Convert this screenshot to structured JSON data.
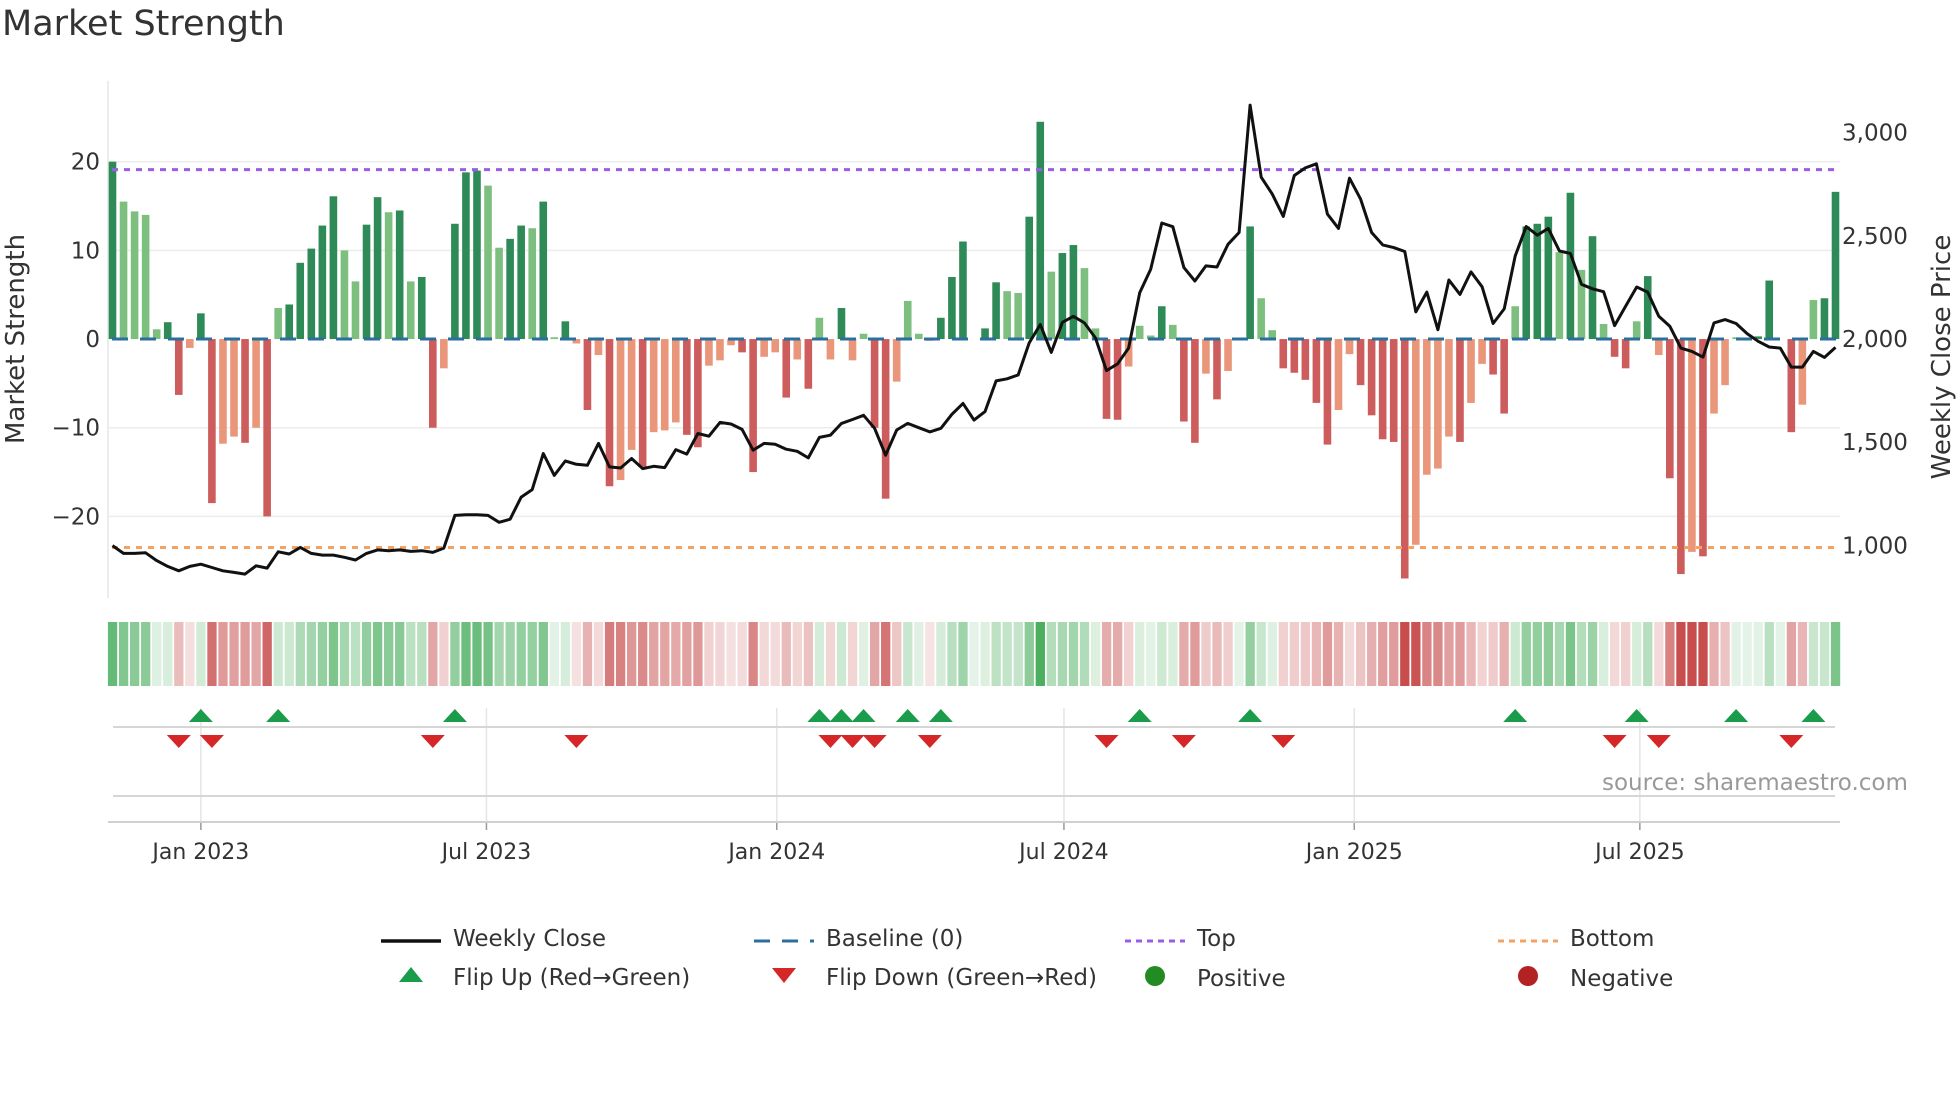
{
  "title": "Market Strength",
  "source": "source: sharemaestro.com",
  "legend": {
    "weekly_close": "Weekly Close",
    "baseline": "Baseline (0)",
    "top": "Top",
    "bottom": "Bottom",
    "flip_up": "Flip Up (Red→Green)",
    "flip_down": "Flip Down (Green→Red)",
    "positive": "Positive",
    "negative": "Negative"
  },
  "colors": {
    "strong_green": "#2e8b57",
    "weak_green": "#7dbf7f",
    "strong_red": "#cd5c5c",
    "weak_red": "#e9967a",
    "line": "#111111",
    "baseline": "#2a6f9e",
    "top": "#9b5de5",
    "bottom": "#f4a261",
    "flip_up": "#1a9c4a",
    "flip_down": "#d62728",
    "positive": "#228b22",
    "negative": "#b22222"
  },
  "chart_data": {
    "type": "bar+line",
    "title": "Market Strength",
    "ylabel": "Market Strength",
    "y2label": "Weekly Close Price",
    "start_date": "2022-11-06",
    "frequency": "weekly",
    "ylim": [
      -29.2,
      29.1
    ],
    "y2lim": [
      745,
      3250
    ],
    "yticks": [
      20,
      10,
      0,
      -10,
      -20
    ],
    "yticklabels": [
      "20",
      "10",
      "0",
      "−10",
      "−20"
    ],
    "y2ticks": [
      3000,
      2500,
      2000,
      1500,
      1000
    ],
    "y2ticklabels": [
      "3,000",
      "2,500",
      "2,000",
      "1,500",
      "1,000"
    ],
    "xticks": [
      "2023-01-01",
      "2023-07-01",
      "2024-01-01",
      "2024-07-01",
      "2025-01-01",
      "2025-07-01"
    ],
    "xticklabels": [
      "Jan 2023",
      "Jul 2023",
      "Jan 2024",
      "Jul 2024",
      "Jan 2025",
      "Jul 2025"
    ],
    "top_level": 19.1,
    "bottom_level": -23.5,
    "baseline": 0,
    "strength": [
      20,
      15.5,
      14.4,
      14,
      1.1,
      1.9,
      -6.3,
      -1,
      2.9,
      -18.5,
      -11.8,
      -11,
      -11.7,
      -10,
      -20,
      3.5,
      3.9,
      8.6,
      10.2,
      12.8,
      16.1,
      10,
      6.5,
      12.9,
      16,
      14.3,
      14.5,
      6.5,
      7,
      -10,
      -3.3,
      13,
      18.8,
      19,
      17.3,
      10.3,
      11.3,
      12.8,
      12.5,
      15.5,
      0.2,
      2,
      -0.5,
      -8,
      -1.8,
      -16.6,
      -15.9,
      -12.5,
      -14.4,
      -10.5,
      -10.3,
      -9.4,
      -10.8,
      -12.2,
      -3,
      -2.4,
      -0.7,
      -1.5,
      -15,
      -2,
      -1.5,
      -6.6,
      -2.3,
      -5.6,
      2.4,
      -2.3,
      3.5,
      -2.4,
      0.6,
      -10,
      -18,
      -4.8,
      4.3,
      0.6,
      -0.2,
      2.4,
      7,
      11,
      0,
      1.2,
      6.4,
      5.4,
      5.2,
      13.8,
      24.5,
      7.6,
      9.7,
      10.6,
      8,
      1.2,
      -9,
      -9.1,
      -3.1,
      1.5,
      0.4,
      3.7,
      1.6,
      -9.3,
      -11.7,
      -3.9,
      -6.8,
      -3.6,
      0,
      12.7,
      4.6,
      1,
      -3.3,
      -3.8,
      -4.6,
      -7.2,
      -11.9,
      -8,
      -1.7,
      -5.2,
      -8.6,
      -11.3,
      -11.6,
      -27,
      -23.2,
      -15.3,
      -14.6,
      -11,
      -11.6,
      -7.2,
      -2.8,
      -4,
      -8.4,
      3.7,
      12.7,
      13,
      13.8,
      9.8,
      16.5,
      7.8,
      11.6,
      1.7,
      -2,
      -3.3,
      2,
      7.1,
      -1.8,
      -15.7,
      -26.5,
      -24,
      -24.5,
      -8.4,
      -5.2,
      0.2,
      0.1,
      0.3,
      6.6,
      0,
      -10.5,
      -7.4,
      4.4,
      4.6,
      16.6
    ],
    "weekly_close": [
      999,
      961,
      961,
      964,
      926,
      898,
      877,
      898,
      909,
      893,
      877,
      869,
      861,
      901,
      890,
      969,
      958,
      990,
      961,
      953,
      953,
      942,
      929,
      961,
      978,
      974,
      978,
      971,
      974,
      966,
      987,
      1145,
      1148,
      1148,
      1145,
      1112,
      1127,
      1234,
      1270,
      1445,
      1339,
      1409,
      1393,
      1388,
      1494,
      1380,
      1375,
      1421,
      1372,
      1383,
      1377,
      1464,
      1442,
      1542,
      1529,
      1596,
      1588,
      1562,
      1461,
      1494,
      1490,
      1466,
      1456,
      1424,
      1523,
      1534,
      1591,
      1610,
      1630,
      1567,
      1437,
      1559,
      1591,
      1570,
      1550,
      1567,
      1635,
      1688,
      1607,
      1648,
      1797,
      1807,
      1826,
      1981,
      2070,
      1935,
      2081,
      2110,
      2078,
      2005,
      1847,
      1880,
      1956,
      2224,
      2338,
      2562,
      2544,
      2346,
      2281,
      2354,
      2349,
      2459,
      2516,
      3133,
      2784,
      2703,
      2594,
      2792,
      2829,
      2849,
      2605,
      2536,
      2779,
      2678,
      2516,
      2456,
      2443,
      2424,
      2131,
      2227,
      2045,
      2286,
      2216,
      2325,
      2253,
      2075,
      2146,
      2402,
      2545,
      2503,
      2536,
      2427,
      2414,
      2265,
      2243,
      2229,
      2065,
      2159,
      2252,
      2227,
      2110,
      2062,
      1956,
      1940,
      1912,
      2078,
      2094,
      2075,
      2026,
      1989,
      1961,
      1956,
      1864,
      1864,
      1940,
      1911,
      1959
    ]
  }
}
